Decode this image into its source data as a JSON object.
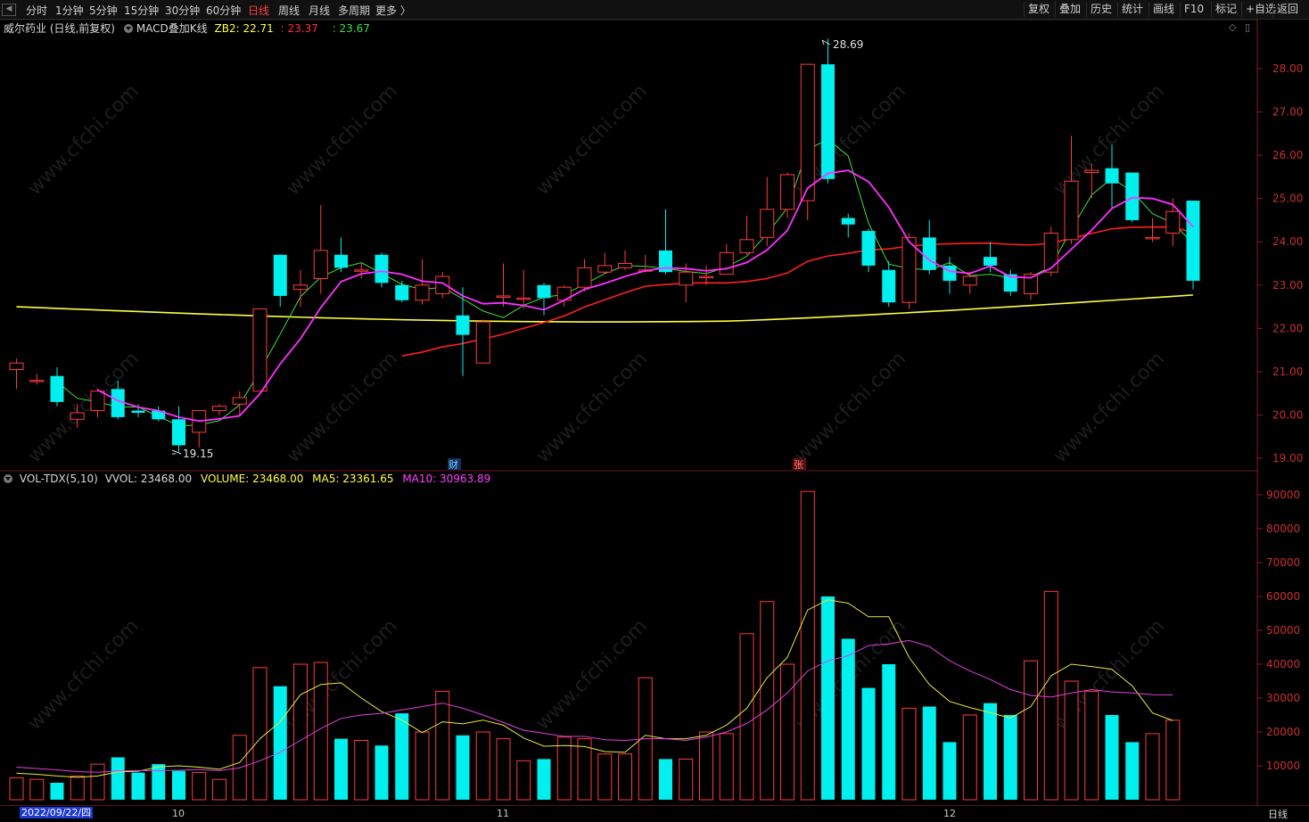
{
  "toolbar": {
    "left_items": [
      "分时",
      "1分钟",
      "5分钟",
      "15分钟",
      "30分钟",
      "60分钟",
      "日线",
      "周线",
      "月线",
      "多周期",
      "更多 〉"
    ],
    "active_item": "日线",
    "right_items": [
      "复权",
      "叠加",
      "历史",
      "统计",
      "画线",
      "F10",
      "标记",
      "+自选",
      "返回"
    ]
  },
  "price_header": {
    "stock": "威尔药业 (日线,前复权)",
    "indicator": "MACD叠加K线",
    "zb2_label": "ZB2: 22.71",
    "v2": ": 23.37",
    "v3": ": 23.67"
  },
  "volume_header": {
    "name": "VOL-TDX(5,10)",
    "vvol": "VVOL: 23468.00",
    "volume": "VOLUME: 23468.00",
    "ma5": "MA5: 23361.65",
    "ma10": "MA10: 30963.89"
  },
  "watermark": "www.cfchi.com",
  "price_axis": [
    "28.00",
    "27.00",
    "26.00",
    "25.00",
    "24.00",
    "23.00",
    "22.00",
    "21.00",
    "20.00",
    "19.00"
  ],
  "volume_axis": [
    "90000",
    "80000",
    "70000",
    "60000",
    "50000",
    "40000",
    "30000",
    "20000",
    "10000"
  ],
  "high_label": "28.69",
  "low_label": "19.15",
  "marker_cai": "财",
  "marker_zhang": "张",
  "status": {
    "date": "2022/09/22/四",
    "months": [
      "10",
      "11",
      "12"
    ],
    "period": "日线"
  },
  "colors": {
    "up": "#ff3b3b",
    "down": "#00f0f0",
    "ma_yellow": "#ffff40",
    "ma_red": "#ff2020",
    "ma_magenta": "#ff30ff",
    "ma_green": "#40e040",
    "ma_blue": "#3030ff",
    "axis": "#8b1a1a"
  },
  "chart_data": {
    "type": "candlestick",
    "candles": [
      {
        "o": 21.05,
        "c": 21.2,
        "h": 21.3,
        "l": 20.6
      },
      {
        "o": 20.8,
        "c": 20.8,
        "h": 20.95,
        "l": 20.7
      },
      {
        "o": 20.9,
        "c": 20.3,
        "h": 21.1,
        "l": 20.2
      },
      {
        "o": 19.9,
        "c": 20.05,
        "h": 20.25,
        "l": 19.7
      },
      {
        "o": 20.1,
        "c": 20.55,
        "h": 20.6,
        "l": 19.95
      },
      {
        "o": 20.6,
        "c": 19.95,
        "h": 20.8,
        "l": 19.9
      },
      {
        "o": 20.1,
        "c": 20.05,
        "h": 20.25,
        "l": 19.95
      },
      {
        "o": 20.1,
        "c": 19.9,
        "h": 20.2,
        "l": 19.85
      },
      {
        "o": 19.9,
        "c": 19.3,
        "h": 20.2,
        "l": 19.15
      },
      {
        "o": 19.6,
        "c": 20.1,
        "h": 20.1,
        "l": 19.25
      },
      {
        "o": 20.1,
        "c": 20.2,
        "h": 20.25,
        "l": 20.0
      },
      {
        "o": 20.25,
        "c": 20.4,
        "h": 20.55,
        "l": 20.0
      },
      {
        "o": 20.55,
        "c": 22.45,
        "h": 22.45,
        "l": 20.55
      },
      {
        "o": 23.7,
        "c": 22.75,
        "h": 23.7,
        "l": 22.5
      },
      {
        "o": 22.9,
        "c": 23.0,
        "h": 23.35,
        "l": 22.5
      },
      {
        "o": 23.15,
        "c": 23.8,
        "h": 24.85,
        "l": 22.8
      },
      {
        "o": 23.7,
        "c": 23.4,
        "h": 24.1,
        "l": 23.3
      },
      {
        "o": 23.35,
        "c": 23.35,
        "h": 23.5,
        "l": 23.15
      },
      {
        "o": 23.7,
        "c": 23.05,
        "h": 23.75,
        "l": 22.95
      },
      {
        "o": 23.0,
        "c": 22.65,
        "h": 23.1,
        "l": 22.6
      },
      {
        "o": 22.65,
        "c": 23.0,
        "h": 23.6,
        "l": 22.55
      },
      {
        "o": 22.8,
        "c": 23.2,
        "h": 23.3,
        "l": 22.7
      },
      {
        "o": 22.3,
        "c": 21.85,
        "h": 22.95,
        "l": 20.9
      },
      {
        "o": 21.2,
        "c": 22.15,
        "h": 22.2,
        "l": 21.2
      },
      {
        "o": 22.75,
        "c": 22.75,
        "h": 23.5,
        "l": 22.5
      },
      {
        "o": 22.7,
        "c": 22.7,
        "h": 23.35,
        "l": 22.45
      },
      {
        "o": 23.0,
        "c": 22.7,
        "h": 23.05,
        "l": 22.3
      },
      {
        "o": 22.65,
        "c": 22.95,
        "h": 23.0,
        "l": 22.5
      },
      {
        "o": 22.95,
        "c": 23.4,
        "h": 23.6,
        "l": 22.85
      },
      {
        "o": 23.3,
        "c": 23.45,
        "h": 23.75,
        "l": 23.25
      },
      {
        "o": 23.4,
        "c": 23.5,
        "h": 23.8,
        "l": 23.35
      },
      {
        "o": 23.35,
        "c": 23.35,
        "h": 23.7,
        "l": 23.3
      },
      {
        "o": 23.8,
        "c": 23.3,
        "h": 24.75,
        "l": 23.25
      },
      {
        "o": 23.0,
        "c": 23.3,
        "h": 23.5,
        "l": 22.6
      },
      {
        "o": 23.2,
        "c": 23.2,
        "h": 23.45,
        "l": 23.0
      },
      {
        "o": 23.25,
        "c": 23.75,
        "h": 23.95,
        "l": 23.25
      },
      {
        "o": 23.75,
        "c": 24.05,
        "h": 24.6,
        "l": 23.7
      },
      {
        "o": 24.1,
        "c": 24.75,
        "h": 25.5,
        "l": 23.9
      },
      {
        "o": 24.75,
        "c": 25.55,
        "h": 25.6,
        "l": 24.55
      },
      {
        "o": 24.95,
        "c": 28.1,
        "h": 28.1,
        "l": 24.5
      },
      {
        "o": 28.1,
        "c": 25.45,
        "h": 28.69,
        "l": 25.35
      },
      {
        "o": 24.55,
        "c": 24.4,
        "h": 24.65,
        "l": 24.1
      },
      {
        "o": 24.25,
        "c": 23.45,
        "h": 24.3,
        "l": 23.3
      },
      {
        "o": 23.35,
        "c": 22.6,
        "h": 23.55,
        "l": 22.5
      },
      {
        "o": 22.6,
        "c": 24.1,
        "h": 24.2,
        "l": 22.45
      },
      {
        "o": 24.1,
        "c": 23.35,
        "h": 24.5,
        "l": 23.25
      },
      {
        "o": 23.45,
        "c": 23.1,
        "h": 23.65,
        "l": 22.8
      },
      {
        "o": 23.0,
        "c": 23.2,
        "h": 23.3,
        "l": 22.8
      },
      {
        "o": 23.65,
        "c": 23.45,
        "h": 24.0,
        "l": 23.3
      },
      {
        "o": 23.25,
        "c": 22.85,
        "h": 23.35,
        "l": 22.75
      },
      {
        "o": 22.8,
        "c": 23.25,
        "h": 23.3,
        "l": 22.65
      },
      {
        "o": 23.3,
        "c": 24.2,
        "h": 24.35,
        "l": 23.2
      },
      {
        "o": 24.05,
        "c": 25.4,
        "h": 26.45,
        "l": 23.95
      },
      {
        "o": 25.6,
        "c": 25.65,
        "h": 25.8,
        "l": 25.0
      },
      {
        "o": 25.7,
        "c": 25.35,
        "h": 26.25,
        "l": 24.75
      },
      {
        "o": 25.6,
        "c": 24.5,
        "h": 25.6,
        "l": 24.45
      },
      {
        "o": 24.1,
        "c": 24.1,
        "h": 24.55,
        "l": 24.0
      },
      {
        "o": 24.2,
        "c": 24.7,
        "h": 25.0,
        "l": 23.9
      },
      {
        "o": 24.95,
        "c": 23.1,
        "h": 24.95,
        "l": 22.9
      }
    ],
    "volume": [
      6500,
      6000,
      5000,
      7000,
      10500,
      12500,
      8000,
      10500,
      8500,
      8000,
      6000,
      19000,
      39000,
      33500,
      40000,
      40500,
      18000,
      17500,
      16000,
      25500,
      20000,
      32000,
      19000,
      20000,
      18000,
      11500,
      12000,
      18500,
      18000,
      13500,
      13500,
      36000,
      12000,
      12000,
      20000,
      19500,
      49000,
      58500,
      40000,
      91000,
      60000,
      47500,
      33000,
      40000,
      27000,
      27500,
      17000,
      25000,
      28500,
      25000,
      41000,
      61500,
      35000,
      32000,
      25000,
      17000,
      19500,
      23468
    ],
    "ma5_volume": [
      7800,
      7500,
      7000,
      6600,
      7000,
      8200,
      8400,
      9700,
      10000,
      9600,
      9000,
      11000,
      18000,
      23000,
      31000,
      34000,
      34500,
      30000,
      26000,
      23500,
      19800,
      23000,
      22400,
      23500,
      22000,
      18200,
      15800,
      16000,
      15700,
      14200,
      14000,
      19000,
      18000,
      18000,
      19000,
      22000,
      27000,
      36000,
      42000,
      56000,
      59000,
      58000,
      54000,
      54000,
      42000,
      34000,
      29000,
      27200,
      25700,
      24100,
      27500,
      36600,
      40000,
      39300,
      38500,
      33600,
      25600,
      23362
    ],
    "ma10_volume": [
      9600,
      9200,
      8800,
      8300,
      8100,
      8500,
      8600,
      8600,
      8700,
      8900,
      8600,
      9400,
      11500,
      14000,
      17500,
      21000,
      24000,
      25000,
      25500,
      26500,
      27500,
      28500,
      27000,
      25000,
      22800,
      20500,
      19600,
      18700,
      18700,
      17700,
      17500,
      18000,
      18000,
      17500,
      18500,
      20000,
      22500,
      26500,
      31500,
      38000,
      41000,
      42500,
      45500,
      46000,
      47000,
      45200,
      41000,
      38000,
      35500,
      32500,
      30800,
      30300,
      31500,
      32500,
      31800,
      31500,
      31000,
      30964
    ]
  }
}
